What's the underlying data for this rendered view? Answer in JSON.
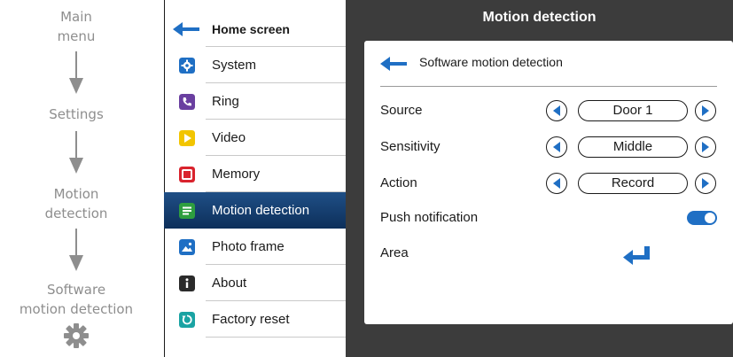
{
  "flow": {
    "steps": [
      [
        "Main",
        "menu"
      ],
      [
        "Settings"
      ],
      [
        "Motion",
        "detection"
      ],
      [
        "Software",
        "motion detection"
      ]
    ],
    "end_icon": "gear-icon"
  },
  "menu": {
    "home_label": "Home screen",
    "items": [
      {
        "label": "System",
        "icon": "gear-icon",
        "color": "#1f6fc4"
      },
      {
        "label": "Ring",
        "icon": "phone-icon",
        "color": "#6a3fa0"
      },
      {
        "label": "Video",
        "icon": "play-icon",
        "color": "#f2c500"
      },
      {
        "label": "Memory",
        "icon": "memory-icon",
        "color": "#d9232d"
      },
      {
        "label": "Motion detection",
        "icon": "list-icon",
        "color": "#2e9e3f",
        "active": true
      },
      {
        "label": "Photo frame",
        "icon": "picture-icon",
        "color": "#1f6fc4"
      },
      {
        "label": "About",
        "icon": "info-icon",
        "color": "#2b2b2b"
      },
      {
        "label": "Factory reset",
        "icon": "reset-icon",
        "color": "#1aa3a3"
      }
    ]
  },
  "panel": {
    "title": "Motion detection",
    "subtitle": "Software motion detection",
    "rows": {
      "source": {
        "label": "Source",
        "value": "Door 1"
      },
      "sensitivity": {
        "label": "Sensitivity",
        "value": "Middle"
      },
      "action": {
        "label": "Action",
        "value": "Record"
      },
      "push": {
        "label": "Push notification",
        "state": "on"
      },
      "area": {
        "label": "Area"
      }
    }
  },
  "colors": {
    "accent_blue": "#1f6fc4",
    "panel_dark": "#3c3c3c",
    "active_item": "#163f70",
    "flow_gray": "#8e8e8e"
  }
}
